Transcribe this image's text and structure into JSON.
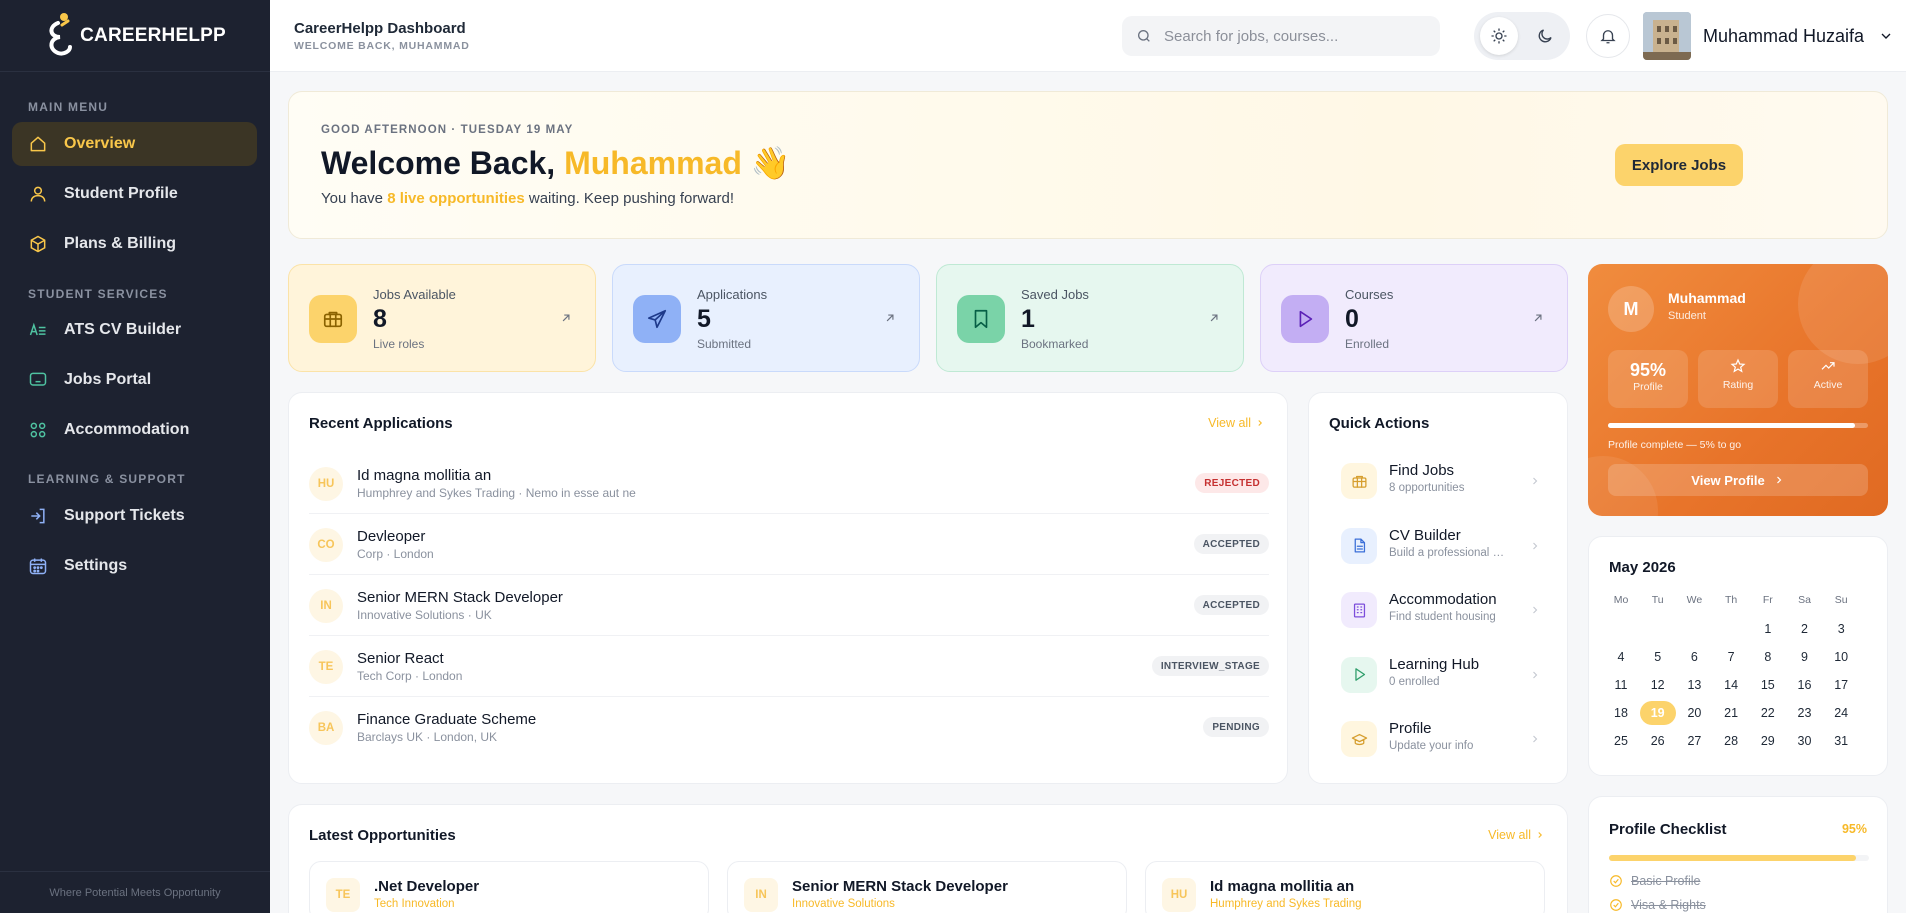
{
  "brand": {
    "name": "CAREERHELPP",
    "accent": "#f9c74a"
  },
  "sidebar": {
    "sections": [
      "MAIN MENU",
      "STUDENT SERVICES",
      "LEARNING & SUPPORT"
    ],
    "items": [
      {
        "label": "Overview",
        "icon": "home-icon",
        "active": true
      },
      {
        "label": "Student Profile",
        "icon": "user-icon"
      },
      {
        "label": "Plans & Billing",
        "icon": "box-icon"
      },
      {
        "label": "ATS CV Builder",
        "icon": "text-lines-icon"
      },
      {
        "label": "Jobs Portal",
        "icon": "monitor-icon"
      },
      {
        "label": "Accommodation",
        "icon": "grid-icon"
      },
      {
        "label": "Support Tickets",
        "icon": "sign-in-icon"
      },
      {
        "label": "Settings",
        "icon": "calendar-grid-icon"
      }
    ],
    "footer": "Where Potential Meets Opportunity"
  },
  "header": {
    "title": "CareerHelpp Dashboard",
    "subtitle": "WELCOME BACK, MUHAMMAD",
    "search_placeholder": "Search for jobs, courses...",
    "user_name": "Muhammad Huzaifa"
  },
  "welcome": {
    "kicker": "GOOD AFTERNOON · TUESDAY 19 MAY",
    "title_prefix": "Welcome Back, ",
    "title_name": "Muhammad",
    "title_emoji": "👋",
    "sub_prefix": "You have ",
    "sub_highlight": "8 live opportunities",
    "sub_suffix": " waiting. Keep pushing forward!",
    "cta": "Explore Jobs"
  },
  "stats": [
    {
      "label": "Jobs Available",
      "value": "8",
      "caption": "Live roles",
      "icon": "briefcase-icon",
      "bg": "#fff4da",
      "border": "#fbe3a8",
      "ic_bg": "#fcd36b",
      "ic_color": "#8a6200"
    },
    {
      "label": "Applications",
      "value": "5",
      "caption": "Submitted",
      "icon": "send-icon",
      "bg": "#e8f0fe",
      "border": "#c9dafb",
      "ic_bg": "#8fb1f6",
      "ic_color": "#1e3a8a"
    },
    {
      "label": "Saved Jobs",
      "value": "1",
      "caption": "Bookmarked",
      "icon": "bookmark-icon",
      "bg": "#e6f7ef",
      "border": "#bfe9d4",
      "ic_bg": "#7ad3a8",
      "ic_color": "#065f46"
    },
    {
      "label": "Courses",
      "value": "0",
      "caption": "Enrolled",
      "icon": "play-icon",
      "bg": "#f1ebfd",
      "border": "#ddd0f8",
      "ic_bg": "#c3aef3",
      "ic_color": "#5b21b6"
    }
  ],
  "profile_card": {
    "initial": "M",
    "name": "Muhammad",
    "role": "Student",
    "completion_value": "95%",
    "completion_label": "Profile",
    "completion_fraction": 0.95,
    "rating_label": "Rating",
    "active_label": "Active",
    "note": "Profile complete — 5% to go",
    "button": "View Profile"
  },
  "recent_applications": {
    "title": "Recent Applications",
    "view_all": "View all",
    "rows": [
      {
        "initials": "HU",
        "title": "Id magna mollitia an",
        "sub": "Humphrey and Sykes Trading · Nemo in esse aut ne",
        "status": "REJECTED",
        "kind": "rejected"
      },
      {
        "initials": "CO",
        "title": "Devleoper",
        "sub": "Corp · London",
        "status": "ACCEPTED",
        "kind": "neutral"
      },
      {
        "initials": "IN",
        "title": "Senior MERN Stack Developer",
        "sub": "Innovative Solutions · UK",
        "status": "ACCEPTED",
        "kind": "neutral"
      },
      {
        "initials": "TE",
        "title": "Senior React",
        "sub": "Tech Corp · London",
        "status": "INTERVIEW_STAGE",
        "kind": "neutral"
      },
      {
        "initials": "BA",
        "title": "Finance Graduate Scheme",
        "sub": "Barclays UK · London, UK",
        "status": "PENDING",
        "kind": "neutral"
      }
    ]
  },
  "quick_actions": {
    "title": "Quick Actions",
    "items": [
      {
        "title": "Find Jobs",
        "sub": "8 opportunities",
        "icon": "briefcase-icon",
        "bg": "#fff6df",
        "color": "#d69e2e"
      },
      {
        "title": "CV Builder",
        "sub": "Build a professional CV",
        "icon": "document-icon",
        "bg": "#e8f0fe",
        "color": "#3b6fd8"
      },
      {
        "title": "Accommodation",
        "sub": "Find student housing",
        "icon": "building-icon",
        "bg": "#f1ebfd",
        "color": "#7c4ddb"
      },
      {
        "title": "Learning Hub",
        "sub": "0 enrolled",
        "icon": "play-icon",
        "bg": "#e6f7ef",
        "color": "#2f9e6b"
      },
      {
        "title": "Profile",
        "sub": "Update your info",
        "icon": "graduation-cap-icon",
        "bg": "#fff6df",
        "color": "#d69e2e"
      }
    ]
  },
  "calendar": {
    "title": "May 2026",
    "weekdays": [
      "Mo",
      "Tu",
      "We",
      "Th",
      "Fr",
      "Sa",
      "Su"
    ],
    "first_weekday_index": 4,
    "days": 31,
    "today": 19
  },
  "checklist": {
    "title": "Profile Checklist",
    "percent": "95%",
    "fraction": 0.95,
    "items": [
      "Basic Profile",
      "Visa & Rights"
    ]
  },
  "opportunities": {
    "title": "Latest Opportunities",
    "view_all": "View all",
    "items": [
      {
        "initials": "TE",
        "title": ".Net Developer",
        "company": "Tech Innovation"
      },
      {
        "initials": "IN",
        "title": "Senior MERN Stack Developer",
        "company": "Innovative Solutions"
      },
      {
        "initials": "HU",
        "title": "Id magna mollitia an",
        "company": "Humphrey and Sykes Trading"
      }
    ]
  }
}
